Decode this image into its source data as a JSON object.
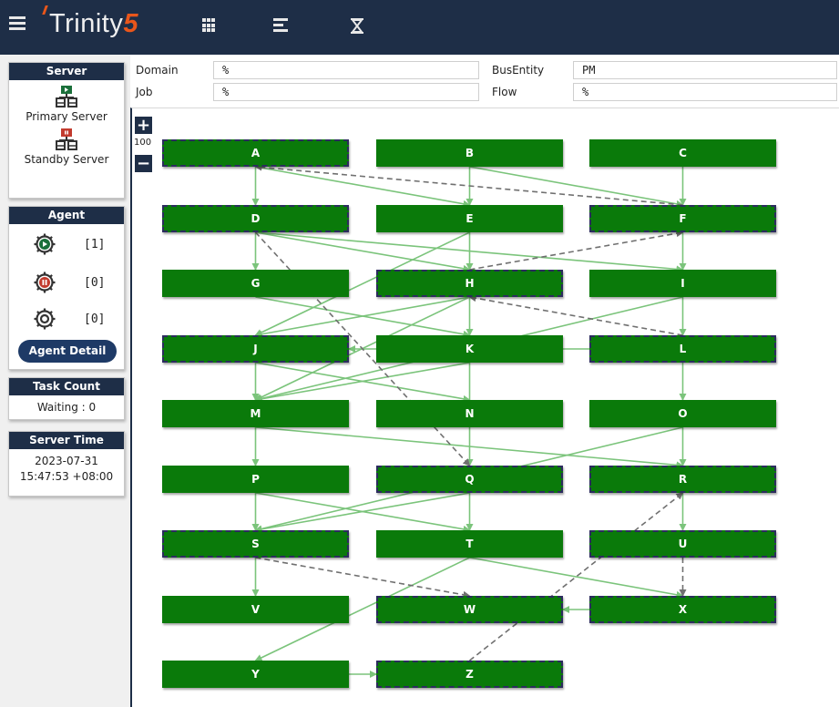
{
  "header": {
    "logo_text": "Trinity",
    "logo_number": "5",
    "icons": [
      "grid-icon",
      "list-icon",
      "hourglass-icon"
    ]
  },
  "sidebar": {
    "server": {
      "title": "Server",
      "primary_label": "Primary Server",
      "standby_label": "Standby Server"
    },
    "agent": {
      "title": "Agent",
      "running_count": "[1]",
      "stopped_count": "[0]",
      "idle_count": "[0]",
      "button_label": "Agent Detail"
    },
    "task": {
      "title": "Task Count",
      "waiting": "Waiting : 0"
    },
    "server_time": {
      "title": "Server Time",
      "date": "2023-07-31",
      "time": "15:47:53 +08:00"
    }
  },
  "filters": {
    "domain_label": "Domain",
    "domain_value": "%",
    "busentity_label": "BusEntity",
    "busentity_value": "PM",
    "job_label": "Job",
    "job_value": "%",
    "flow_label": "Flow",
    "flow_value": "%"
  },
  "graph": {
    "zoom_in": "+",
    "zoom_out": "−",
    "zoom_level": "100",
    "nodes": [
      {
        "id": "A",
        "label": "A",
        "dashed": true
      },
      {
        "id": "B",
        "label": "B",
        "dashed": false
      },
      {
        "id": "C",
        "label": "C",
        "dashed": false
      },
      {
        "id": "D",
        "label": "D",
        "dashed": true
      },
      {
        "id": "E",
        "label": "E",
        "dashed": false
      },
      {
        "id": "F",
        "label": "F",
        "dashed": true
      },
      {
        "id": "G",
        "label": "G",
        "dashed": false
      },
      {
        "id": "H",
        "label": "H",
        "dashed": true
      },
      {
        "id": "I",
        "label": "I",
        "dashed": false
      },
      {
        "id": "J",
        "label": "J",
        "dashed": true
      },
      {
        "id": "K",
        "label": "K",
        "dashed": false
      },
      {
        "id": "L",
        "label": "L",
        "dashed": true
      },
      {
        "id": "M",
        "label": "M",
        "dashed": false
      },
      {
        "id": "N",
        "label": "N",
        "dashed": false
      },
      {
        "id": "O",
        "label": "O",
        "dashed": false
      },
      {
        "id": "P",
        "label": "P",
        "dashed": false
      },
      {
        "id": "Q",
        "label": "Q",
        "dashed": true
      },
      {
        "id": "R",
        "label": "R",
        "dashed": true
      },
      {
        "id": "S",
        "label": "S",
        "dashed": true
      },
      {
        "id": "T",
        "label": "T",
        "dashed": false
      },
      {
        "id": "U",
        "label": "U",
        "dashed": true
      },
      {
        "id": "V",
        "label": "V",
        "dashed": false
      },
      {
        "id": "W",
        "label": "W",
        "dashed": true
      },
      {
        "id": "X",
        "label": "X",
        "dashed": true
      },
      {
        "id": "Y",
        "label": "Y",
        "dashed": false
      },
      {
        "id": "Z",
        "label": "Z",
        "dashed": true
      }
    ],
    "edges": [
      [
        "A",
        "D",
        "solid"
      ],
      [
        "A",
        "E",
        "solid"
      ],
      [
        "B",
        "F",
        "solid"
      ],
      [
        "C",
        "F",
        "solid"
      ],
      [
        "B",
        "E",
        "solid"
      ],
      [
        "D",
        "G",
        "solid"
      ],
      [
        "D",
        "H",
        "solid"
      ],
      [
        "D",
        "I",
        "solid"
      ],
      [
        "E",
        "H",
        "solid"
      ],
      [
        "E",
        "J",
        "solid"
      ],
      [
        "F",
        "I",
        "solid"
      ],
      [
        "G",
        "K",
        "solid"
      ],
      [
        "H",
        "J",
        "solid"
      ],
      [
        "H",
        "K",
        "solid"
      ],
      [
        "H",
        "M",
        "solid"
      ],
      [
        "I",
        "L",
        "solid"
      ],
      [
        "I",
        "M",
        "solid"
      ],
      [
        "J",
        "M",
        "solid"
      ],
      [
        "J",
        "N",
        "solid"
      ],
      [
        "K",
        "M",
        "solid"
      ],
      [
        "K",
        "Q",
        "solid"
      ],
      [
        "L",
        "O",
        "solid"
      ],
      [
        "L",
        "J",
        "solid"
      ],
      [
        "M",
        "P",
        "solid"
      ],
      [
        "M",
        "R",
        "solid"
      ],
      [
        "O",
        "R",
        "solid"
      ],
      [
        "O",
        "S",
        "solid"
      ],
      [
        "P",
        "S",
        "solid"
      ],
      [
        "P",
        "T",
        "solid"
      ],
      [
        "Q",
        "S",
        "solid"
      ],
      [
        "Q",
        "T",
        "solid"
      ],
      [
        "R",
        "U",
        "solid"
      ],
      [
        "S",
        "V",
        "solid"
      ],
      [
        "T",
        "X",
        "solid"
      ],
      [
        "T",
        "Y",
        "solid"
      ],
      [
        "X",
        "W",
        "solid"
      ],
      [
        "Y",
        "Z",
        "solid"
      ],
      [
        "F",
        "A",
        "dashed"
      ],
      [
        "D",
        "Q",
        "dashed"
      ],
      [
        "H",
        "F",
        "dashed"
      ],
      [
        "L",
        "H",
        "dashed"
      ],
      [
        "S",
        "W",
        "dashed"
      ],
      [
        "Z",
        "R",
        "dashed"
      ],
      [
        "U",
        "X",
        "dashed"
      ]
    ],
    "colors": {
      "node_fill": "#0a7a0a",
      "solid_edge": "#7bc47b",
      "dashed_edge": "#707070",
      "header_bg": "#1e2e47",
      "accent_orange": "#e9561b"
    }
  }
}
